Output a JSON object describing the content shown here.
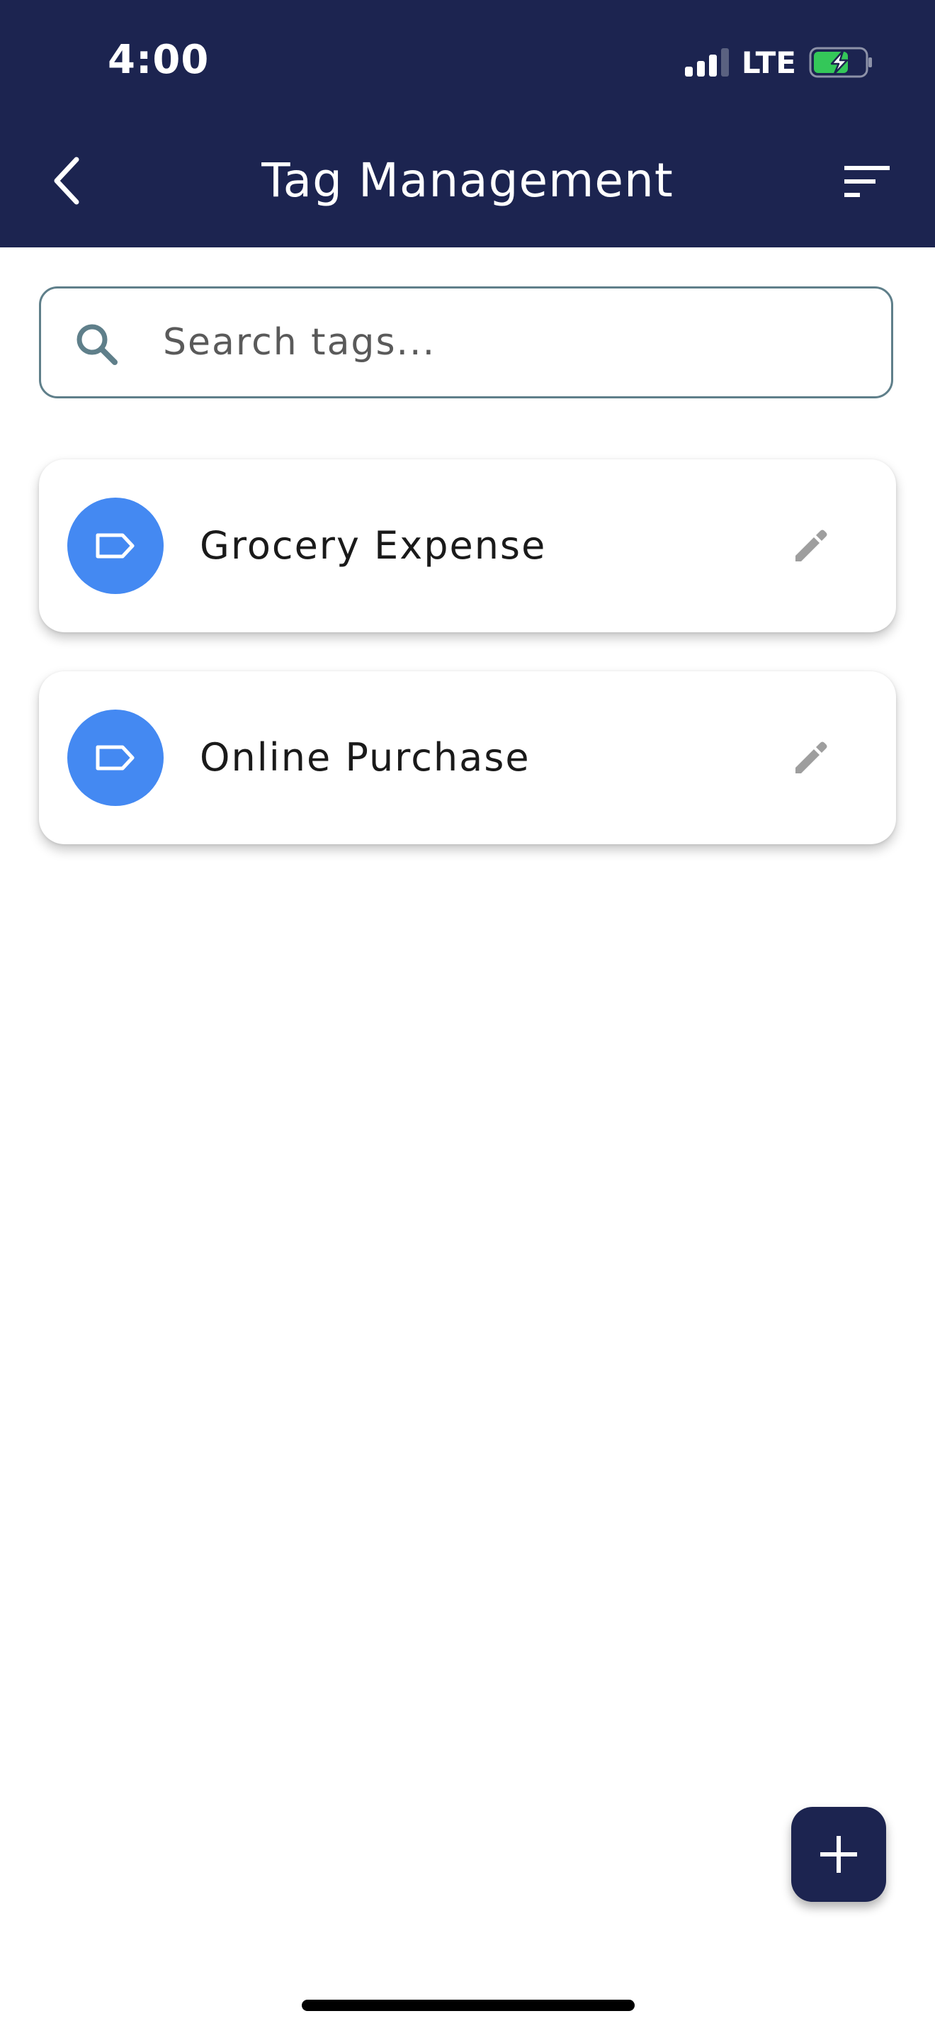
{
  "status_bar": {
    "time": "4:00",
    "network": "LTE",
    "icons": [
      "signal-icon",
      "battery-charging-icon"
    ]
  },
  "header": {
    "title": "Tag Management",
    "back_icon": "chevron-left-icon",
    "sort_icon": "sort-icon"
  },
  "search": {
    "placeholder": "Search tags...",
    "value": "",
    "icon": "search-icon"
  },
  "tags": [
    {
      "name": "Grocery Expense",
      "icon": "tag-icon",
      "action_icon": "pencil-icon"
    },
    {
      "name": "Online Purchase",
      "icon": "tag-icon",
      "action_icon": "pencil-icon"
    }
  ],
  "fab": {
    "icon": "plus-icon"
  },
  "colors": {
    "header_bg": "#1c2450",
    "tag_avatar": "#4489f2",
    "search_border": "#5f7f8a",
    "edit_icon": "#9e9e9e",
    "fab_bg": "#1c2450",
    "battery_fill": "#34c759"
  }
}
